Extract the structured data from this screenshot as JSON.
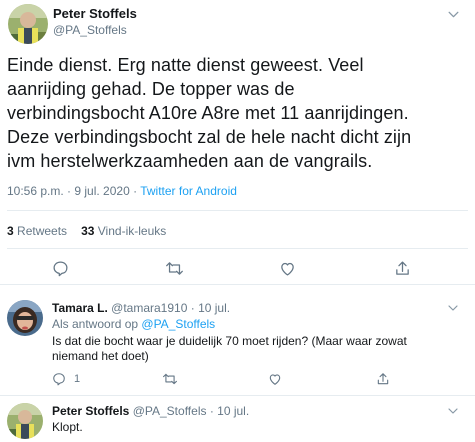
{
  "main_tweet": {
    "author_name": "Peter Stoffels",
    "author_handle": "@PA_Stoffels",
    "text": "Einde dienst. Erg natte dienst geweest.  Veel\naanrijding gehad. De topper was de\nverbindingsbocht A10re A8re met 11 aanrijdingen.\nDeze verbindingsbocht zal de hele nacht dicht zijn\nivm herstelwerkzaamheden aan de vangrails.",
    "timestamp": "10:56 p.m. · 9 jul. 2020 · ",
    "source": "Twitter for Android",
    "retweets_count": "3",
    "retweets_label": "Retweets",
    "likes_count": "33",
    "likes_label": "Vind-ik-leuks",
    "actions": [
      "reply-icon",
      "retweet-icon",
      "like-icon",
      "share-icon"
    ]
  },
  "replies": [
    {
      "author_name": "Tamara L.",
      "author_handle": "@tamara1910",
      "date": "· 10 jul.",
      "reply_to_prefix": "Als antwoord op ",
      "reply_to_handle": "@PA_Stoffels",
      "text": "Is dat die bocht waar je duidelijk 70 moet rijden? (Maar waar zowat niemand het doet)",
      "reply_count": "1"
    },
    {
      "author_name": "Peter Stoffels",
      "author_handle": "@PA_Stoffels",
      "date": "· 10 jul.",
      "text": "Klopt."
    }
  ],
  "colors": {
    "link": "#1da1f2",
    "secondary_text": "#657786",
    "divider": "#e6ecf0"
  }
}
